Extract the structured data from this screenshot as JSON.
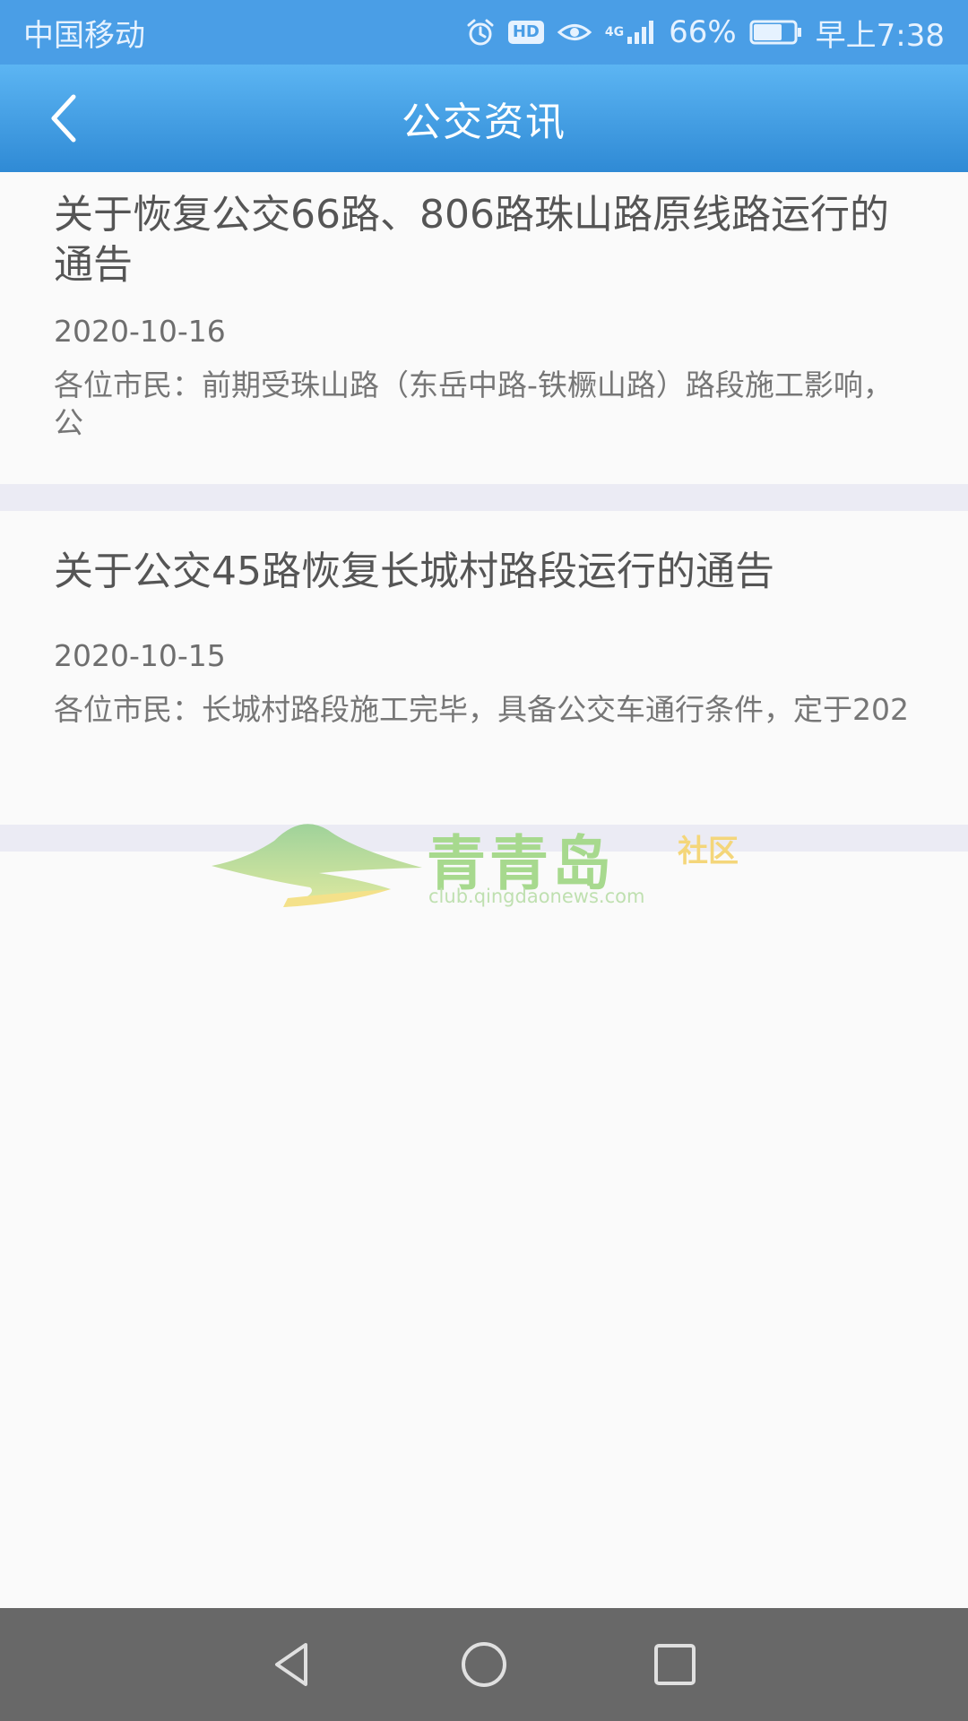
{
  "status_bar": {
    "carrier": "中国移动",
    "network": "4G",
    "hd_label": "HD",
    "battery": "66%",
    "time": "早上7:38"
  },
  "header": {
    "title": "公交资讯"
  },
  "news": [
    {
      "title": "关于恢复公交66路、806路珠山路原线路运行的通告",
      "date": "2020-10-16",
      "snippet": "各位市民：前期受珠山路（东岳中路-铁橛山路）路段施工影响，公"
    },
    {
      "title": "关于公交45路恢复长城村路段运行的通告",
      "date": "2020-10-15",
      "snippet": "各位市民：长城村路段施工完毕，具备公交车通行条件，定于202"
    }
  ],
  "watermark": {
    "title": "青青岛",
    "sub": "社区",
    "url": "club.qingdaonews.com"
  },
  "colors": {
    "status_bar": "#4a9ee6",
    "app_bar": "#3d9be4",
    "separator": "#ebebf4",
    "nav_bar": "#686868"
  }
}
